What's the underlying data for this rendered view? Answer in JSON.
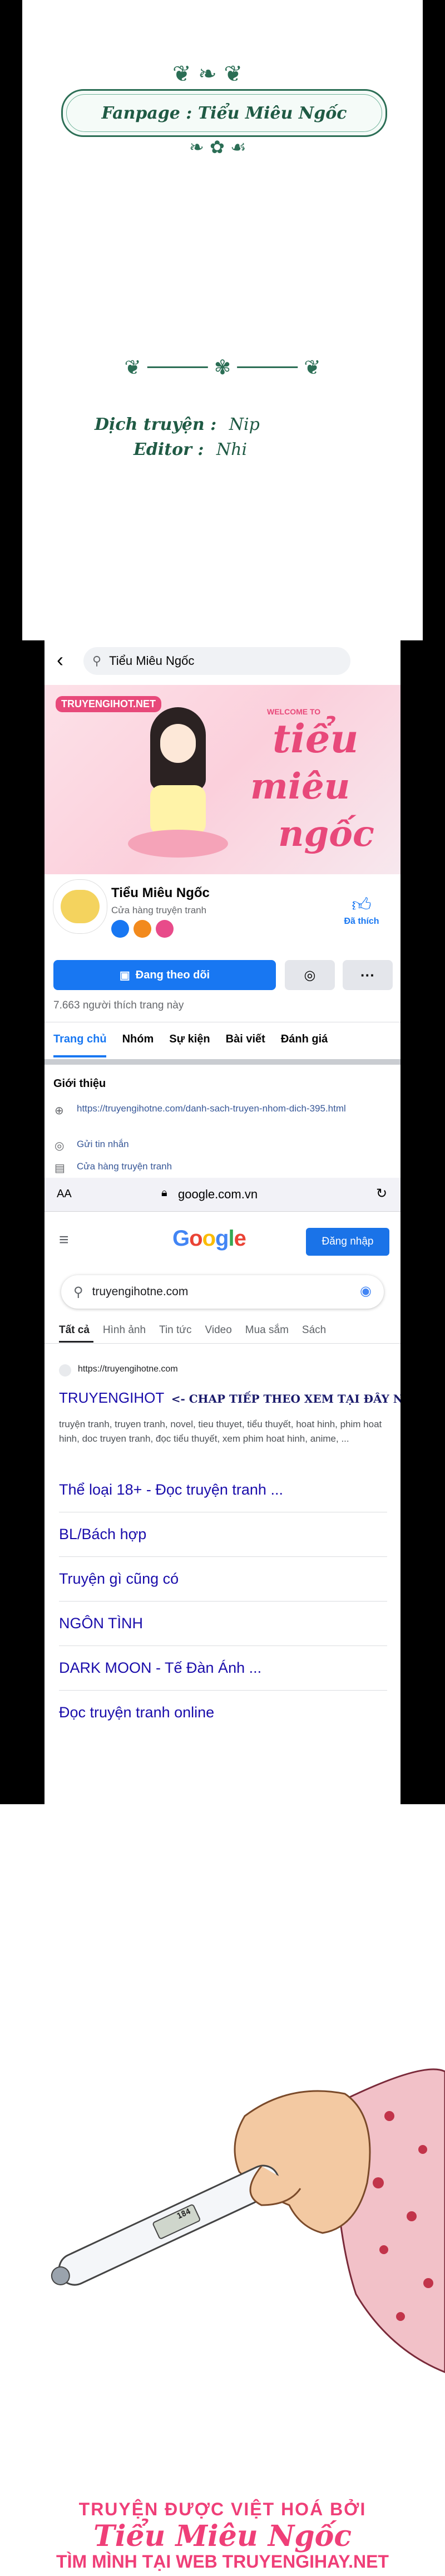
{
  "credits": {
    "fanpage": "Fanpage : Tiểu Miêu Ngốc",
    "translator_label": "Dịch truyện :",
    "translator_name": "Nip",
    "editor_label": "Editor :",
    "editor_name": "Nhi"
  },
  "facebook": {
    "search_text": "Tiểu Miêu Ngốc",
    "cover_site": "TRUYENGIHOT.NET",
    "cover_welcome": "WELCOME TO",
    "cover_title_1": "tiểu",
    "cover_title_2": "miêu",
    "cover_title_3": "ngốc",
    "page_name": "Tiểu Miêu Ngốc",
    "page_category": "Cửa hàng truyện tranh",
    "liked_label": "Đã thích",
    "follow_button": "Đang theo dõi",
    "likes_count": "7.663 người thích trang này",
    "tabs": [
      "Trang chủ",
      "Nhóm",
      "Sự kiện",
      "Bài viết",
      "Đánh giá"
    ],
    "intro_title": "Giới thiệu",
    "intro_link": "https://truyengihotne.com/danh-sach-truyen-nhom-dich-395.html",
    "intro_message": "Gửi tin nhắn",
    "intro_category": "Cửa hàng truyện tranh"
  },
  "browser": {
    "aa_label": "AA",
    "url": "google.com.vn"
  },
  "google": {
    "logo": "Google",
    "signin_button": "Đăng nhập",
    "query": "truyengihotne.com",
    "tabs": [
      "Tất cả",
      "Hình ảnh",
      "Tin tức",
      "Video",
      "Mua sắm",
      "Sách"
    ],
    "result_url": "https://truyengihotne.com",
    "result_title": "TRUYENGIHOT",
    "result_banner": "<- CHAP TIẾP THEO XEM TẠI ĐÂY NHA",
    "result_snippet": "truyện tranh, truyen tranh, novel, tieu thuyet, tiểu thuyết, hoat hinh, phim hoat hinh, doc truyen tranh, đọc tiểu thuyết, xem phim hoat hinh, anime, ...",
    "links": [
      "Thể loại 18+ - Đọc truyện tranh ...",
      "BL/Bách hợp",
      "Truyện gì cũng có",
      "NGÔN TÌNH",
      "DARK MOON - Tế Đàn Ánh ...",
      "Đọc truyện tranh online"
    ]
  },
  "art": {
    "thermometer_reading": "184",
    "watermark_1": "TRUYỆN ĐƯỢC VIỆT HOÁ BỞI",
    "watermark_2": "Tiểu Miêu Ngốc",
    "watermark_3": "TÌM MÌNH TẠI WEB TRUYENGIHAY.NET"
  }
}
